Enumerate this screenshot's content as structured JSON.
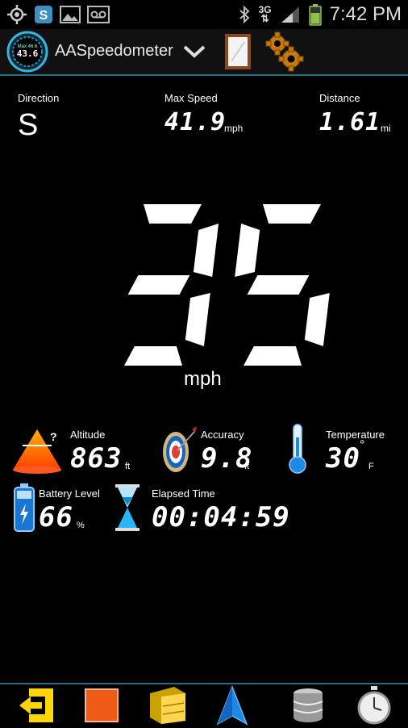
{
  "status_bar": {
    "time": "7:42 PM",
    "network": "3G",
    "icons": [
      "gps-icon",
      "skype-icon",
      "gallery-icon",
      "voicemail-icon",
      "bluetooth-icon",
      "signal-icon",
      "battery-icon"
    ]
  },
  "action_bar": {
    "title": "AASpeedometer",
    "logo_text_top": "Max 46.6",
    "logo_text_value": "43.6",
    "icons": [
      "app-logo-icon",
      "chevron-down-icon",
      "hud-mirror-icon",
      "settings-gears-icon"
    ]
  },
  "top_stats": {
    "direction": {
      "label": "Direction",
      "value": "S"
    },
    "max_speed": {
      "label": "Max Speed",
      "value": "41.9",
      "unit": "mph"
    },
    "distance": {
      "label": "Distance",
      "value": "1.61",
      "unit": "mi"
    }
  },
  "speed": {
    "value": "35",
    "unit": "mph"
  },
  "tiles": {
    "altitude": {
      "label": "Altitude",
      "value": "863",
      "unit": "ft"
    },
    "accuracy": {
      "label": "Accuracy",
      "value": "9.8",
      "unit": "ft"
    },
    "temperature": {
      "label": "Temperature",
      "value": "30",
      "degree": "°",
      "unit": "F"
    },
    "battery": {
      "label": "Battery Level",
      "value": "66",
      "unit": "%"
    },
    "elapsed": {
      "label": "Elapsed Time",
      "value": "00:04:59"
    }
  },
  "bottom_bar": {
    "buttons": [
      "exit-icon",
      "stop-icon",
      "log-folder-icon",
      "navigation-arrow-icon",
      "database-icon",
      "stopwatch-icon"
    ]
  },
  "colors": {
    "accent": "#2a6e86",
    "background": "#000000",
    "text": "#ffffff"
  }
}
